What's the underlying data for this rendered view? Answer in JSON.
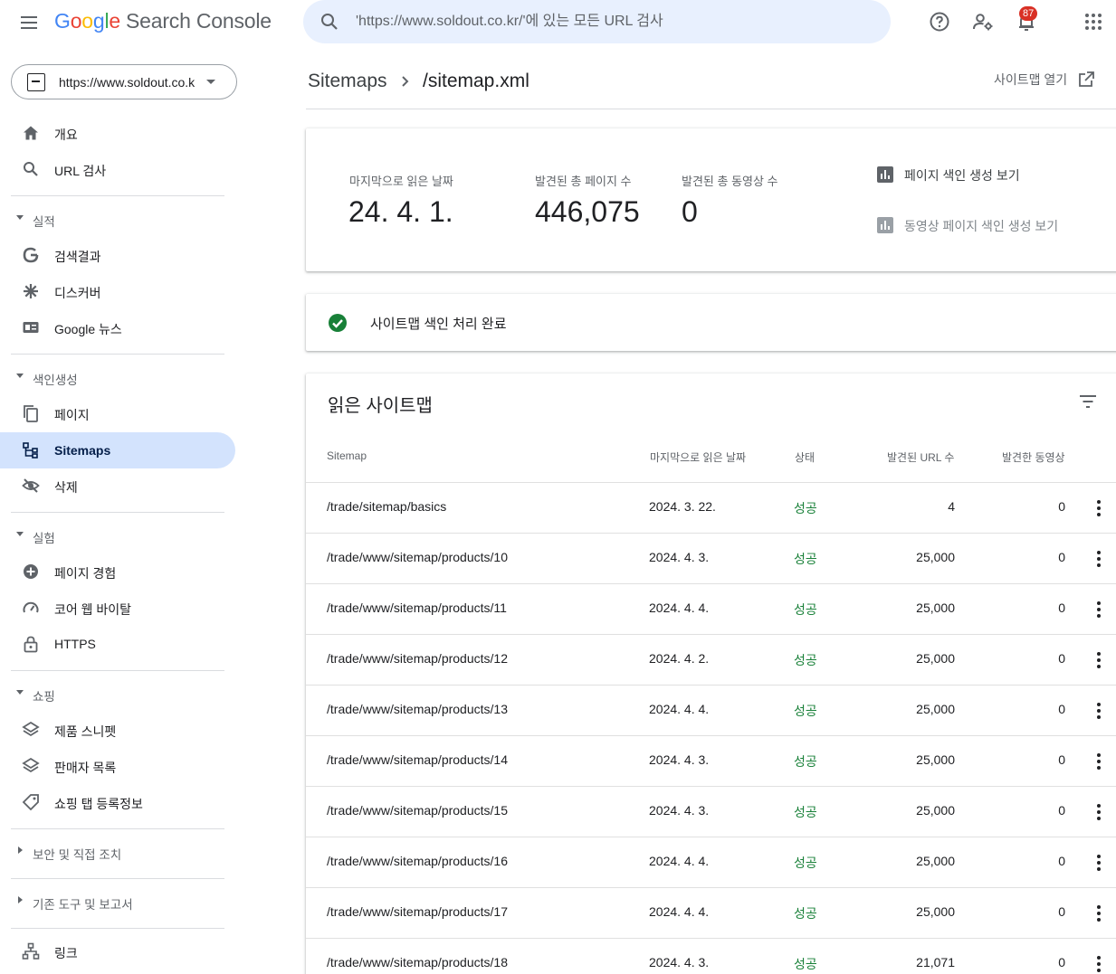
{
  "header": {
    "logo_letters": [
      "G",
      "o",
      "o",
      "g",
      "l",
      "e"
    ],
    "product": "Search Console",
    "search_placeholder": "'https://www.soldout.co.kr/'에 있는 모든 URL 검사",
    "notification_count": "87"
  },
  "sidebar": {
    "property": "https://www.soldout.co.kr/",
    "items": {
      "overview": "개요",
      "url_inspection": "URL 검사",
      "performance": "실적",
      "search_results": "검색결과",
      "discover": "디스커버",
      "google_news": "Google 뉴스",
      "indexing": "색인생성",
      "pages": "페이지",
      "sitemaps": "Sitemaps",
      "removals": "삭제",
      "experience": "실험",
      "page_experience": "페이지 경험",
      "core_web_vitals": "코어 웹 바이탈",
      "https": "HTTPS",
      "shopping": "쇼핑",
      "product_snippets": "제품 스니펫",
      "merchant_listings": "판매자 목록",
      "shopping_tab": "쇼핑 탭 등록정보",
      "security": "보안 및 직접 조치",
      "legacy": "기존 도구 및 보고서",
      "links": "링크"
    }
  },
  "main": {
    "breadcrumb_parent": "Sitemaps",
    "breadcrumb_current": "/sitemap.xml",
    "open_sitemap": "사이트맵 열기",
    "stats": {
      "last_read_label": "마지막으로 읽은 날짜",
      "last_read_value": "24. 4. 1.",
      "pages_label": "발견된 총 페이지 수",
      "pages_value": "446,075",
      "videos_label": "발견된 총 동영상 수",
      "videos_value": "0",
      "link_pages": "페이지 색인 생성 보기",
      "link_videos": "동영상 페이지 색인 생성 보기"
    },
    "status": "사이트맵 색인 처리 완료",
    "table": {
      "title": "읽은 사이트맵",
      "headers": [
        "Sitemap",
        "마지막으로 읽은 날짜",
        "상태",
        "발견된 URL 수",
        "발견한 동영상"
      ],
      "rows": [
        [
          "/trade/sitemap/basics",
          "2024. 3. 22.",
          "성공",
          "4",
          "0"
        ],
        [
          "/trade/www/sitemap/products/10",
          "2024. 4. 3.",
          "성공",
          "25,000",
          "0"
        ],
        [
          "/trade/www/sitemap/products/11",
          "2024. 4. 4.",
          "성공",
          "25,000",
          "0"
        ],
        [
          "/trade/www/sitemap/products/12",
          "2024. 4. 2.",
          "성공",
          "25,000",
          "0"
        ],
        [
          "/trade/www/sitemap/products/13",
          "2024. 4. 4.",
          "성공",
          "25,000",
          "0"
        ],
        [
          "/trade/www/sitemap/products/14",
          "2024. 4. 3.",
          "성공",
          "25,000",
          "0"
        ],
        [
          "/trade/www/sitemap/products/15",
          "2024. 4. 3.",
          "성공",
          "25,000",
          "0"
        ],
        [
          "/trade/www/sitemap/products/16",
          "2024. 4. 4.",
          "성공",
          "25,000",
          "0"
        ],
        [
          "/trade/www/sitemap/products/17",
          "2024. 4. 4.",
          "성공",
          "25,000",
          "0"
        ],
        [
          "/trade/www/sitemap/products/18",
          "2024. 4. 3.",
          "성공",
          "21,071",
          "0"
        ]
      ]
    }
  },
  "colors": {
    "accent": "#1a73e8",
    "active_nav": "#d3e3fd",
    "success": "#188038",
    "badge": "#d93025"
  }
}
